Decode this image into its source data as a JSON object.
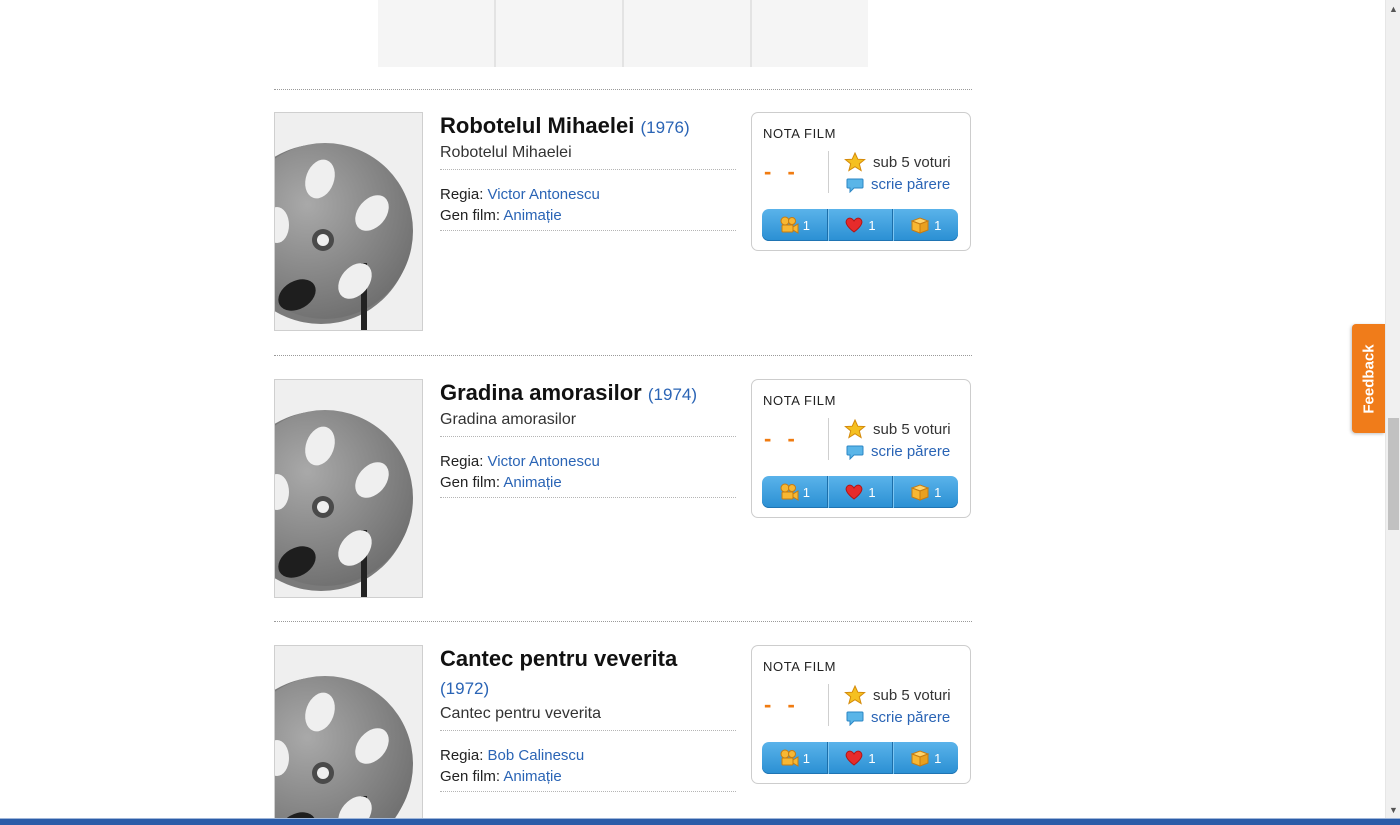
{
  "rating_box": {
    "label": "NOTA FILM",
    "score": "- -",
    "votes_text": "sub 5 voturi",
    "opinion_link": "scrie părere",
    "buttons": {
      "watch_count": "1",
      "fav_count": "1",
      "box_count": "1"
    }
  },
  "movies": [
    {
      "title": "Robotelul Mihaelei",
      "year": "(1976)",
      "original_title": "Robotelul Mihaelei",
      "director_label": "Regia:",
      "director": "Victor Antonescu",
      "genre_label": "Gen film:",
      "genre": "Animație"
    },
    {
      "title": "Gradina amorasilor",
      "year": "(1974)",
      "original_title": "Gradina amorasilor",
      "director_label": "Regia:",
      "director": "Victor Antonescu",
      "genre_label": "Gen film:",
      "genre": "Animație"
    },
    {
      "title": "Cantec pentru veverita",
      "year": "(1972)",
      "original_title": "Cantec pentru veverita",
      "director_label": "Regia:",
      "director": "Bob Calinescu",
      "genre_label": "Gen film:",
      "genre": "Animație"
    }
  ],
  "feedback_tab": {
    "label": "Feedback"
  },
  "colors": {
    "link": "#2a64b5",
    "accent_orange": "#f07b10",
    "button_blue": "#3d9fdf"
  }
}
